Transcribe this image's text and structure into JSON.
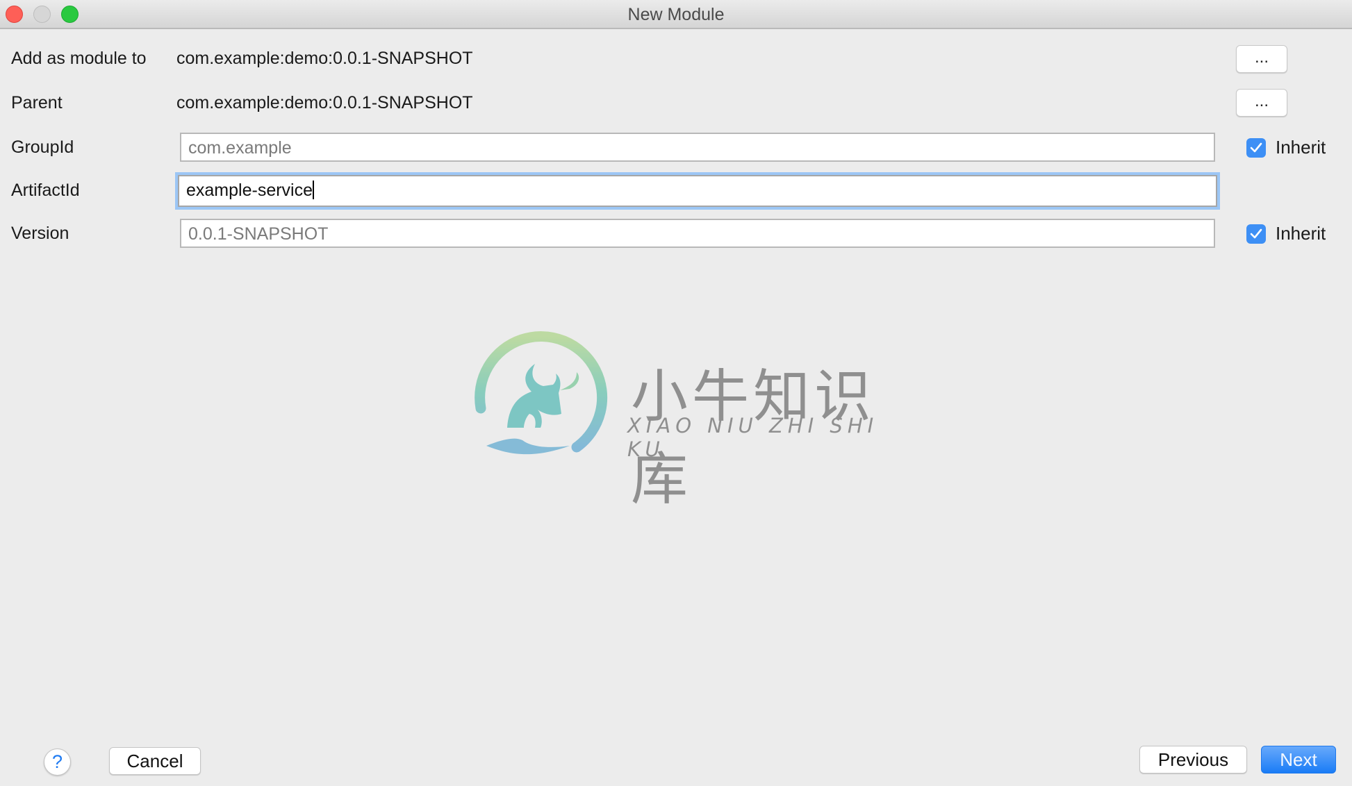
{
  "window": {
    "title": "New Module",
    "controls": [
      "close",
      "minimize",
      "maximize"
    ]
  },
  "form": {
    "add_as_module_to": {
      "label": "Add as module to",
      "value": "com.example:demo:0.0.1-SNAPSHOT",
      "browse_label": "..."
    },
    "parent": {
      "label": "Parent",
      "value": "com.example:demo:0.0.1-SNAPSHOT",
      "browse_label": "..."
    },
    "group_id": {
      "label": "GroupId",
      "value": "com.example",
      "inherit_label": "Inherit",
      "inherit_checked": true
    },
    "artifact_id": {
      "label": "ArtifactId",
      "value": "example-service"
    },
    "version": {
      "label": "Version",
      "value": "0.0.1-SNAPSHOT",
      "inherit_label": "Inherit",
      "inherit_checked": true
    }
  },
  "watermark": {
    "chinese": "小牛知识库",
    "pinyin": "XIAO NIU ZHI SHI KU"
  },
  "footer": {
    "help_label": "?",
    "cancel_label": "Cancel",
    "previous_label": "Previous",
    "next_label": "Next"
  },
  "colors": {
    "accent": "#1a7cf6",
    "checkbox": "#3d8ff5",
    "focus_ring": "#9cc6f5",
    "close": "#fe5f57",
    "maximize": "#2ac940"
  }
}
